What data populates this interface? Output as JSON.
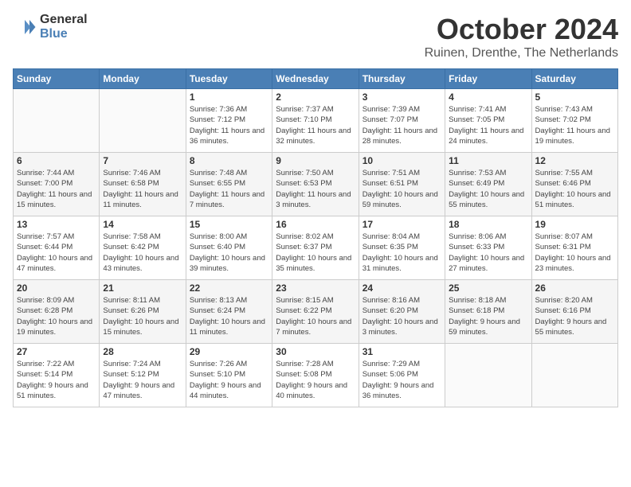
{
  "header": {
    "logo_general": "General",
    "logo_blue": "Blue",
    "title": "October 2024",
    "subtitle": "Ruinen, Drenthe, The Netherlands"
  },
  "weekdays": [
    "Sunday",
    "Monday",
    "Tuesday",
    "Wednesday",
    "Thursday",
    "Friday",
    "Saturday"
  ],
  "weeks": [
    [
      {
        "day": "",
        "info": ""
      },
      {
        "day": "",
        "info": ""
      },
      {
        "day": "1",
        "info": "Sunrise: 7:36 AM\nSunset: 7:12 PM\nDaylight: 11 hours and 36 minutes."
      },
      {
        "day": "2",
        "info": "Sunrise: 7:37 AM\nSunset: 7:10 PM\nDaylight: 11 hours and 32 minutes."
      },
      {
        "day": "3",
        "info": "Sunrise: 7:39 AM\nSunset: 7:07 PM\nDaylight: 11 hours and 28 minutes."
      },
      {
        "day": "4",
        "info": "Sunrise: 7:41 AM\nSunset: 7:05 PM\nDaylight: 11 hours and 24 minutes."
      },
      {
        "day": "5",
        "info": "Sunrise: 7:43 AM\nSunset: 7:02 PM\nDaylight: 11 hours and 19 minutes."
      }
    ],
    [
      {
        "day": "6",
        "info": "Sunrise: 7:44 AM\nSunset: 7:00 PM\nDaylight: 11 hours and 15 minutes."
      },
      {
        "day": "7",
        "info": "Sunrise: 7:46 AM\nSunset: 6:58 PM\nDaylight: 11 hours and 11 minutes."
      },
      {
        "day": "8",
        "info": "Sunrise: 7:48 AM\nSunset: 6:55 PM\nDaylight: 11 hours and 7 minutes."
      },
      {
        "day": "9",
        "info": "Sunrise: 7:50 AM\nSunset: 6:53 PM\nDaylight: 11 hours and 3 minutes."
      },
      {
        "day": "10",
        "info": "Sunrise: 7:51 AM\nSunset: 6:51 PM\nDaylight: 10 hours and 59 minutes."
      },
      {
        "day": "11",
        "info": "Sunrise: 7:53 AM\nSunset: 6:49 PM\nDaylight: 10 hours and 55 minutes."
      },
      {
        "day": "12",
        "info": "Sunrise: 7:55 AM\nSunset: 6:46 PM\nDaylight: 10 hours and 51 minutes."
      }
    ],
    [
      {
        "day": "13",
        "info": "Sunrise: 7:57 AM\nSunset: 6:44 PM\nDaylight: 10 hours and 47 minutes."
      },
      {
        "day": "14",
        "info": "Sunrise: 7:58 AM\nSunset: 6:42 PM\nDaylight: 10 hours and 43 minutes."
      },
      {
        "day": "15",
        "info": "Sunrise: 8:00 AM\nSunset: 6:40 PM\nDaylight: 10 hours and 39 minutes."
      },
      {
        "day": "16",
        "info": "Sunrise: 8:02 AM\nSunset: 6:37 PM\nDaylight: 10 hours and 35 minutes."
      },
      {
        "day": "17",
        "info": "Sunrise: 8:04 AM\nSunset: 6:35 PM\nDaylight: 10 hours and 31 minutes."
      },
      {
        "day": "18",
        "info": "Sunrise: 8:06 AM\nSunset: 6:33 PM\nDaylight: 10 hours and 27 minutes."
      },
      {
        "day": "19",
        "info": "Sunrise: 8:07 AM\nSunset: 6:31 PM\nDaylight: 10 hours and 23 minutes."
      }
    ],
    [
      {
        "day": "20",
        "info": "Sunrise: 8:09 AM\nSunset: 6:28 PM\nDaylight: 10 hours and 19 minutes."
      },
      {
        "day": "21",
        "info": "Sunrise: 8:11 AM\nSunset: 6:26 PM\nDaylight: 10 hours and 15 minutes."
      },
      {
        "day": "22",
        "info": "Sunrise: 8:13 AM\nSunset: 6:24 PM\nDaylight: 10 hours and 11 minutes."
      },
      {
        "day": "23",
        "info": "Sunrise: 8:15 AM\nSunset: 6:22 PM\nDaylight: 10 hours and 7 minutes."
      },
      {
        "day": "24",
        "info": "Sunrise: 8:16 AM\nSunset: 6:20 PM\nDaylight: 10 hours and 3 minutes."
      },
      {
        "day": "25",
        "info": "Sunrise: 8:18 AM\nSunset: 6:18 PM\nDaylight: 9 hours and 59 minutes."
      },
      {
        "day": "26",
        "info": "Sunrise: 8:20 AM\nSunset: 6:16 PM\nDaylight: 9 hours and 55 minutes."
      }
    ],
    [
      {
        "day": "27",
        "info": "Sunrise: 7:22 AM\nSunset: 5:14 PM\nDaylight: 9 hours and 51 minutes."
      },
      {
        "day": "28",
        "info": "Sunrise: 7:24 AM\nSunset: 5:12 PM\nDaylight: 9 hours and 47 minutes."
      },
      {
        "day": "29",
        "info": "Sunrise: 7:26 AM\nSunset: 5:10 PM\nDaylight: 9 hours and 44 minutes."
      },
      {
        "day": "30",
        "info": "Sunrise: 7:28 AM\nSunset: 5:08 PM\nDaylight: 9 hours and 40 minutes."
      },
      {
        "day": "31",
        "info": "Sunrise: 7:29 AM\nSunset: 5:06 PM\nDaylight: 9 hours and 36 minutes."
      },
      {
        "day": "",
        "info": ""
      },
      {
        "day": "",
        "info": ""
      }
    ]
  ]
}
